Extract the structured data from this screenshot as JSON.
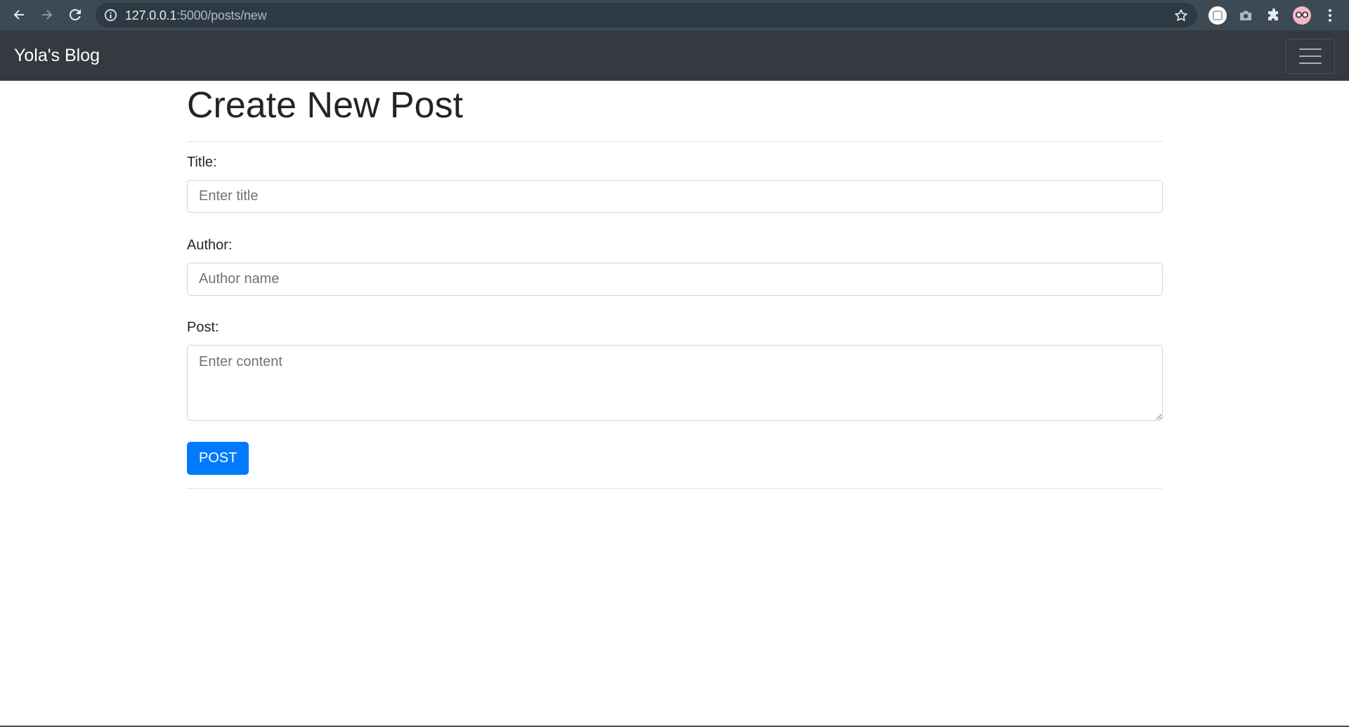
{
  "browser": {
    "url_host": "127.0.0.1",
    "url_rest": ":5000/posts/new",
    "icons": [
      "back-icon",
      "forward-icon",
      "reload-icon",
      "info-icon",
      "star-icon",
      "extension-icon",
      "camera-icon",
      "puzzle-icon",
      "avatar",
      "menu-icon"
    ]
  },
  "navbar": {
    "brand": "Yola's Blog"
  },
  "page": {
    "title": "Create New Post"
  },
  "form": {
    "title_label": "Title:",
    "title_placeholder": "Enter title",
    "title_value": "",
    "author_label": "Author:",
    "author_placeholder": "Author name",
    "author_value": "",
    "post_label": "Post:",
    "post_placeholder": "Enter content",
    "post_value": "",
    "submit_label": "POST"
  },
  "colors": {
    "navbar_bg": "#343a40",
    "primary": "#007bff",
    "chrome_bg": "#3c4a55"
  }
}
